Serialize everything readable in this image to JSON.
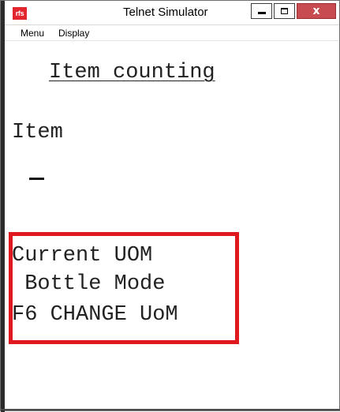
{
  "window": {
    "title": "Telnet Simulator",
    "app_icon_text": "rfs",
    "controls": {
      "minimize_icon": "minimize-icon",
      "maximize_icon": "maximize-icon",
      "close_glyph": "x"
    }
  },
  "menu": {
    "items": [
      "Menu",
      "Display"
    ]
  },
  "screen": {
    "heading": "Item counting",
    "item_label": "Item",
    "uom_lines": [
      "Current UOM",
      " Bottle Mode",
      "F6 CHANGE UoM"
    ]
  },
  "colors": {
    "highlight": "#e0191f",
    "app_icon_bg": "#e3262e",
    "close_button_bg": "#c74b50"
  }
}
